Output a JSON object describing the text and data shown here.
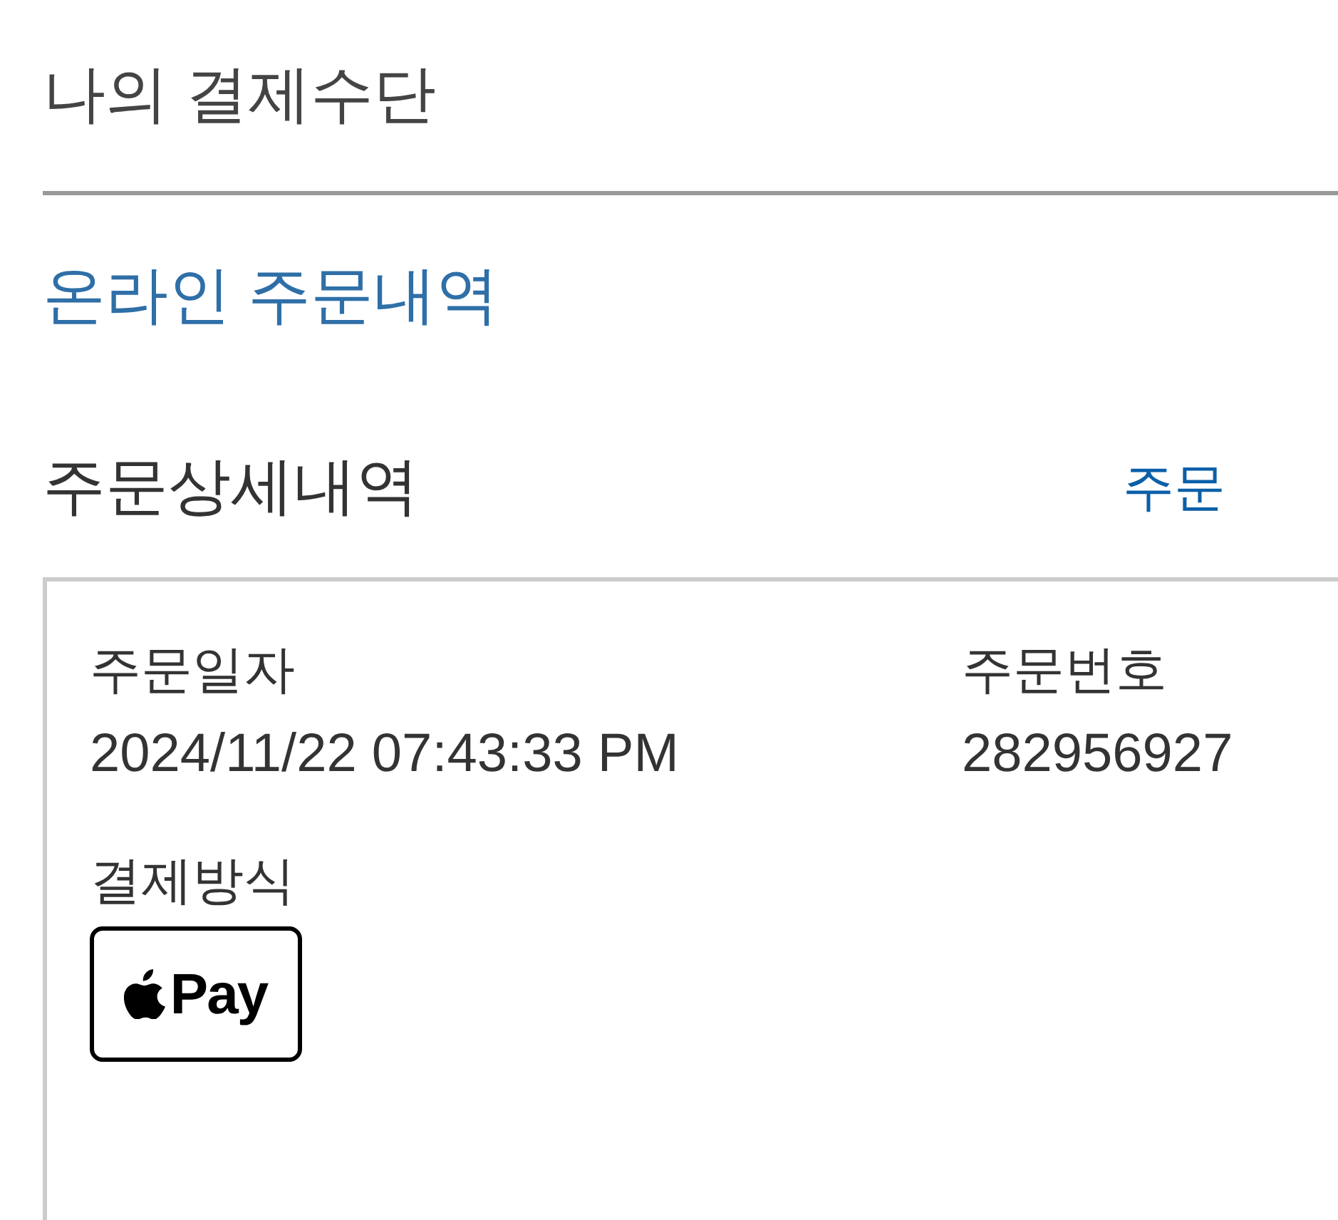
{
  "page_title": "나의 결제수단",
  "order_history_link": "온라인 주문내역",
  "section": {
    "title": "주문상세내역",
    "link": "주문"
  },
  "order": {
    "fields": [
      {
        "label": "주문일자",
        "value": "2024/11/22 07:43:33 PM"
      },
      {
        "label": "주문번호",
        "value": "282956927"
      }
    ],
    "payment": {
      "label": "결제방식",
      "method": {
        "kind": "apple_pay",
        "text": "Pay"
      }
    }
  }
}
